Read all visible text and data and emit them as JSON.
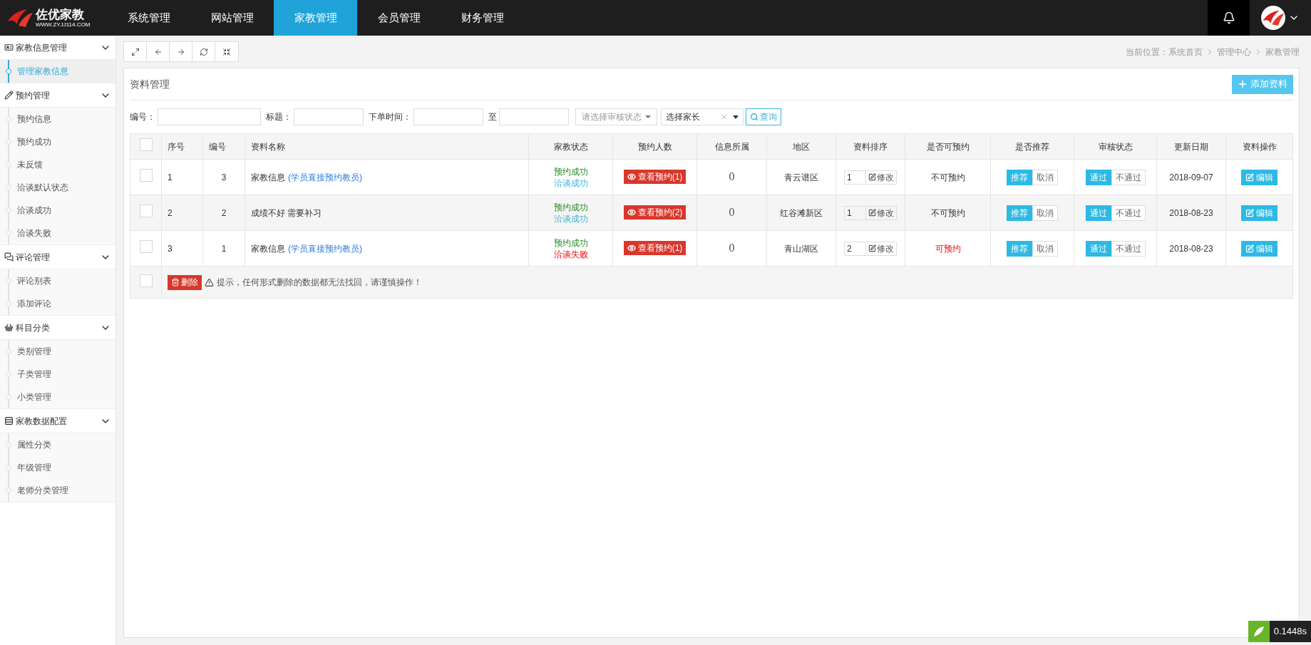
{
  "logo": {
    "title": "佐优家教",
    "subtitle": "WWW.ZYJJ114.COM"
  },
  "nav": [
    {
      "label": "系统管理",
      "selected": false
    },
    {
      "label": "网站管理",
      "selected": false
    },
    {
      "label": "家教管理",
      "selected": true
    },
    {
      "label": "会员管理",
      "selected": false
    },
    {
      "label": "财务管理",
      "selected": false
    }
  ],
  "sidebar": [
    {
      "title": "家教信息管理",
      "expanded": true,
      "items": [
        {
          "label": "管理家教信息",
          "selected": true
        }
      ]
    },
    {
      "title": "预约管理",
      "expanded": true,
      "items": [
        {
          "label": "预约信息",
          "selected": false
        },
        {
          "label": "预约成功",
          "selected": false
        },
        {
          "label": "未反馈",
          "selected": false
        },
        {
          "label": "洽谈默认状态",
          "selected": false
        },
        {
          "label": "洽谈成功",
          "selected": false
        },
        {
          "label": "洽谈失败",
          "selected": false
        }
      ]
    },
    {
      "title": "评论管理",
      "expanded": true,
      "items": [
        {
          "label": "评论别表",
          "selected": false
        },
        {
          "label": "添加评论",
          "selected": false
        }
      ]
    },
    {
      "title": "科目分类",
      "expanded": true,
      "items": [
        {
          "label": "类别管理",
          "selected": false
        },
        {
          "label": "子类管理",
          "selected": false
        },
        {
          "label": "小类管理",
          "selected": false
        }
      ]
    },
    {
      "title": "家教数据配置",
      "expanded": true,
      "items": [
        {
          "label": "属性分类",
          "selected": false
        },
        {
          "label": "年级管理",
          "selected": false
        },
        {
          "label": "老师分类管理",
          "selected": false
        }
      ]
    }
  ],
  "breadcrumb": [
    "当前位置：系统首页",
    "管理中心",
    "家教管理"
  ],
  "panel": {
    "title": "资料管理",
    "add_button": "添加资料"
  },
  "filters": {
    "fields": [
      {
        "label": "编号："
      },
      {
        "label": "标题："
      },
      {
        "label": "下单时间："
      },
      {
        "label": "至"
      }
    ],
    "status_select": {
      "placeholder": "请选择审核状态"
    },
    "parent_select": {
      "value": "选择家长"
    },
    "search_button": "查询"
  },
  "table": {
    "header_checked": false,
    "columns": [
      "序号",
      "编号",
      "资料名称",
      "家教状态",
      "预约人数",
      "信息所属",
      "地区",
      "资料排序",
      "是否可预约",
      "是否推荐",
      "审核状态",
      "更新日期",
      "资料操作"
    ],
    "rows": [
      {
        "checked": false,
        "seq": "1",
        "id": "3",
        "name": "家教信息",
        "link": "(学员直接预约教员)",
        "status": [
          {
            "text": "预约成功",
            "kind": "booked"
          },
          {
            "text": "洽谈成功",
            "kind": "agreed"
          }
        ],
        "view_button": "查看预约(1)",
        "info": "0",
        "region": "青云谱区",
        "sort": "1",
        "sort_button": "修改",
        "bookable": {
          "text": "不可预约",
          "kind": "closed"
        },
        "recommend": [
          {
            "label": "推荐",
            "selected": true
          },
          {
            "label": "取消",
            "selected": false
          }
        ],
        "audit": [
          {
            "label": "通过",
            "selected": true
          },
          {
            "label": "不通过",
            "selected": false
          }
        ],
        "date": "2018-09-07",
        "edit_button": "编辑"
      },
      {
        "checked": false,
        "seq": "2",
        "id": "2",
        "name": "成绩不好 需要补习",
        "status": [
          {
            "text": "预约成功",
            "kind": "booked"
          },
          {
            "text": "洽谈成功",
            "kind": "agreed"
          }
        ],
        "view_button": "查看预约(2)",
        "info": "0",
        "region": "红谷滩新区",
        "sort": "1",
        "sort_button": "修改",
        "bookable": {
          "text": "不可预约",
          "kind": "closed"
        },
        "recommend": [
          {
            "label": "推荐",
            "selected": true
          },
          {
            "label": "取消",
            "selected": false
          }
        ],
        "audit": [
          {
            "label": "通过",
            "selected": true
          },
          {
            "label": "不通过",
            "selected": false
          }
        ],
        "date": "2018-08-23",
        "edit_button": "编辑"
      },
      {
        "checked": false,
        "seq": "3",
        "id": "1",
        "name": "家教信息",
        "link": "(学员直接预约教员)",
        "status": [
          {
            "text": "预约成功",
            "kind": "booked"
          },
          {
            "text": "洽谈失败",
            "kind": "failed"
          }
        ],
        "view_button": "查看预约(1)",
        "info": "0",
        "region": "青山湖区",
        "sort": "2",
        "sort_button": "修改",
        "bookable": {
          "text": "可预约",
          "kind": "open"
        },
        "recommend": [
          {
            "label": "推荐",
            "selected": true
          },
          {
            "label": "取消",
            "selected": false
          }
        ],
        "audit": [
          {
            "label": "通过",
            "selected": true
          },
          {
            "label": "不通过",
            "selected": false
          }
        ],
        "date": "2018-08-23",
        "edit_button": "编辑"
      }
    ],
    "footer": {
      "checked": false,
      "delete_button": "删除",
      "warning": "提示，任何形式删除的数据都无法找回，请谨慎操作！"
    }
  },
  "timer": "0.1448s"
}
